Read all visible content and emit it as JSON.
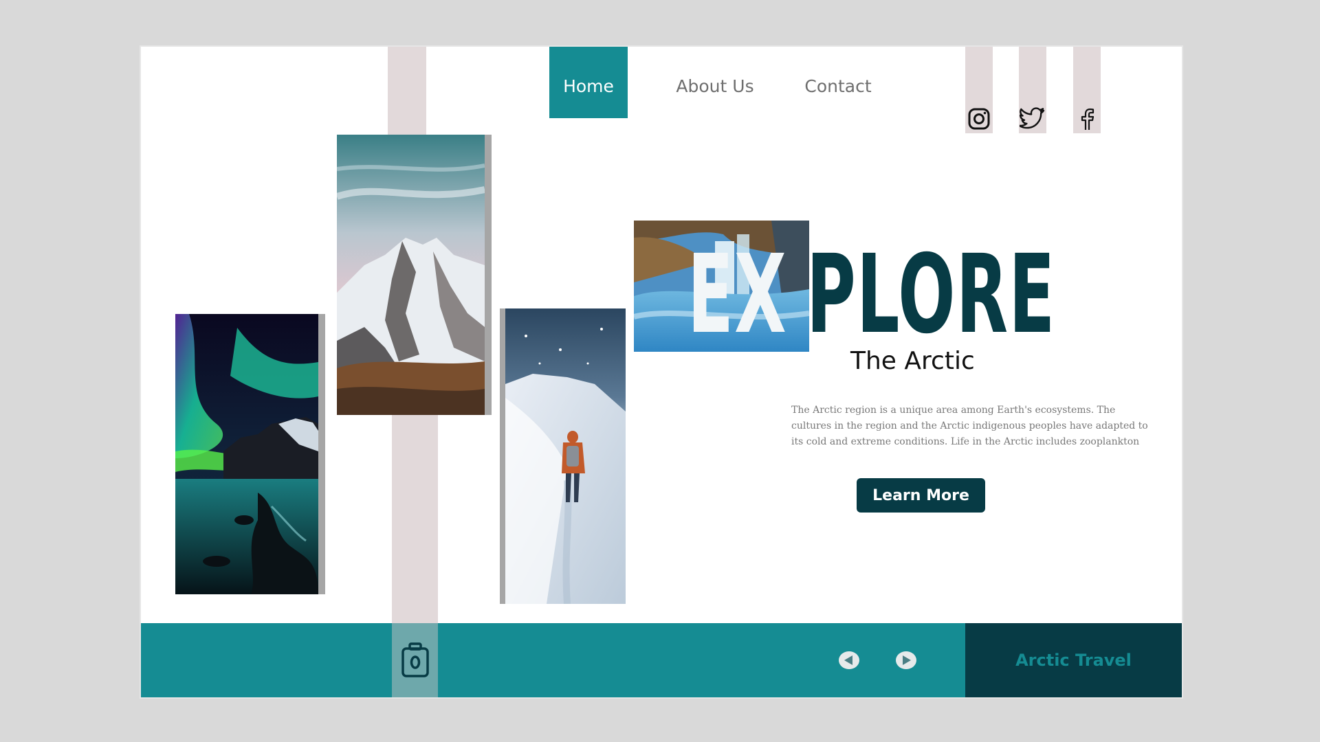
{
  "nav": {
    "items": [
      {
        "label": "Home",
        "active": true
      },
      {
        "label": "About Us",
        "active": false
      },
      {
        "label": "Contact",
        "active": false
      }
    ]
  },
  "social": [
    "instagram-icon",
    "twitter-icon",
    "facebook-icon"
  ],
  "hero": {
    "title_left": "EX",
    "title_right": "PLORE",
    "subtitle": "The Arctic",
    "description": "The Arctic region is a unique area among Earth's ecosystems. The cultures in the region and the Arctic indigenous peoples have adapted to its cold and extreme conditions. Life in the Arctic includes zooplankton",
    "cta_label": "Learn More"
  },
  "footer": {
    "brand": "Arctic Travel",
    "icons": [
      "camera-icon",
      "prev-arrow-icon",
      "next-arrow-icon"
    ]
  },
  "colors": {
    "teal": "#158c93",
    "dark_teal": "#073b45",
    "stripe": "#e2d9da",
    "background": "#d9d9d9"
  }
}
